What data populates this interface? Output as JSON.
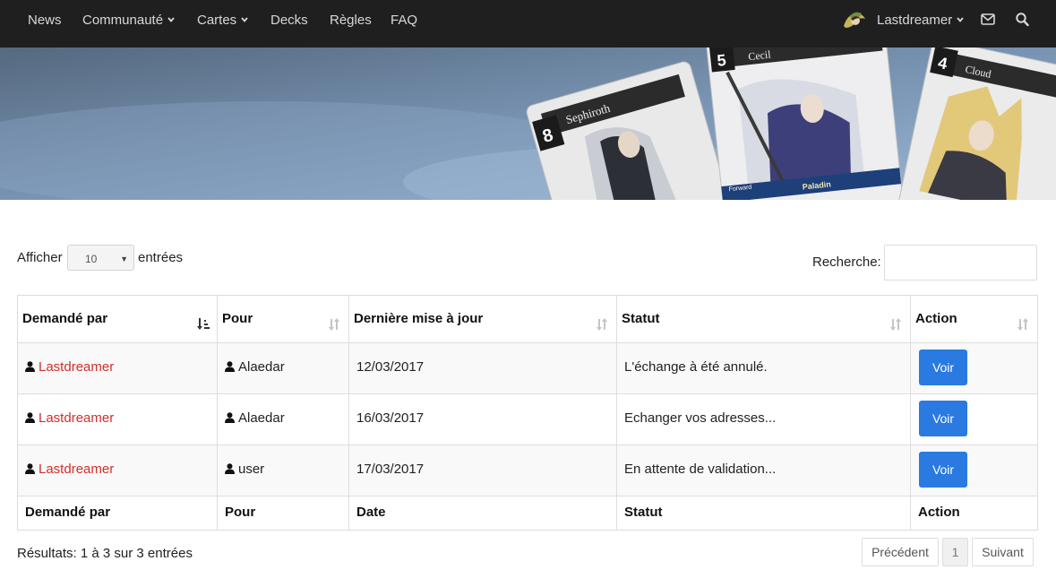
{
  "nav": {
    "items": [
      "News",
      "Communauté",
      "Cartes",
      "Decks",
      "Règles",
      "FAQ"
    ],
    "user": "Lastdreamer"
  },
  "banner": {
    "cards": [
      {
        "cost": "8",
        "name": "Sephiroth"
      },
      {
        "cost": "5",
        "name": "Cecil",
        "job": "Paladin",
        "element": "Forward"
      },
      {
        "cost": "4",
        "name": "Cloud"
      }
    ]
  },
  "controls": {
    "show_label": "Afficher",
    "length_value": "10",
    "entries_label": "entrées",
    "search_label": "Recherche:",
    "search_value": ""
  },
  "table": {
    "headers": [
      "Demandé par",
      "Pour",
      "Dernière mise à jour",
      "Statut",
      "Action"
    ],
    "footers": [
      "Demandé par",
      "Pour",
      "Date",
      "Statut",
      "Action"
    ],
    "rows": [
      {
        "from": "Lastdreamer",
        "to": "Alaedar",
        "date": "12/03/2017",
        "status": "L'échange à été annulé.",
        "action": "Voir"
      },
      {
        "from": "Lastdreamer",
        "to": "Alaedar",
        "date": "16/03/2017",
        "status": "Echanger vos adresses...",
        "action": "Voir"
      },
      {
        "from": "Lastdreamer",
        "to": "user",
        "date": "17/03/2017",
        "status": "En attente de validation...",
        "action": "Voir"
      }
    ]
  },
  "footer": {
    "info": "Résultats: 1 à 3 sur 3 entrées",
    "prev": "Précédent",
    "page": "1",
    "next": "Suivant"
  },
  "colors": {
    "accent": "#2a7ae2",
    "link": "#d0302c",
    "navbar": "#1f1f1f"
  }
}
